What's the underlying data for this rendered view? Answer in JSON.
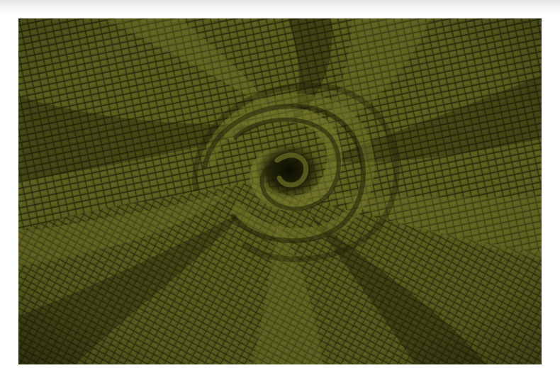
{
  "image": {
    "subject": "fabric-swatch",
    "colors": {
      "base": "#55591b",
      "light": "#6f7328",
      "dark": "#2e300b",
      "grid": "#23240a",
      "page_background": "#ffffff"
    }
  }
}
